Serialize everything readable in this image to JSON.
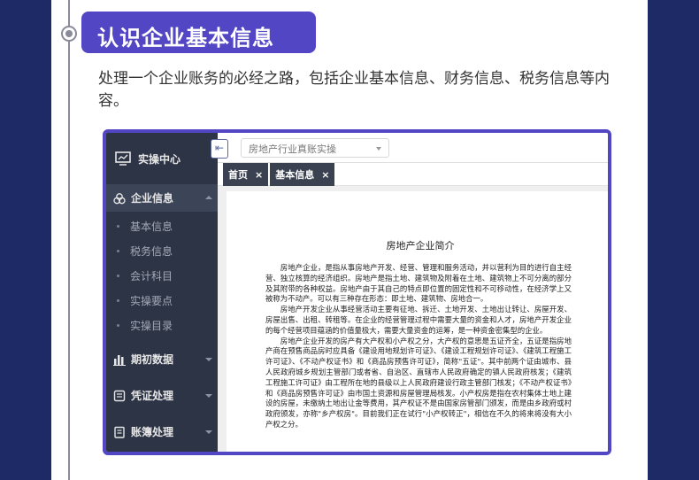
{
  "section": {
    "title": "认识企业基本信息",
    "description": "处理一个企业账务的必经之路，包括企业基本信息、财务信息、税务信息等内容。"
  },
  "app": {
    "sidebar": {
      "header": "实操中心",
      "items": [
        {
          "label": "企业信息",
          "icon": "company-icon",
          "expanded": true
        },
        {
          "label": "期初数据",
          "icon": "bar-chart-icon"
        },
        {
          "label": "凭证处理",
          "icon": "voucher-icon"
        },
        {
          "label": "账簿处理",
          "icon": "ledger-icon"
        }
      ],
      "sub_items": [
        "基本信息",
        "税务信息",
        "会计科目",
        "实操要点",
        "实操目录"
      ]
    },
    "topbar": {
      "collapse_icon": "collapse-icon",
      "select_value": "房地产行业真账实操"
    },
    "tabs": [
      {
        "label": "首页",
        "close": "×"
      },
      {
        "label": "基本信息",
        "close": "×"
      }
    ],
    "document": {
      "title": "房地产企业简介",
      "paragraphs": [
        "房地产企业，是指从事房地产开发、经营、管理和服务活动，并以营利为目的进行自主经营、独立核算的经济组织。房地产是指土地、建筑物及附着在土地、建筑物上不可分离的部分及其附带的各种权益。房地产由于其自己的特点即位置的固定性和不可移动性，在经济学上又被称为不动产。可以有三种存在形态：即土地、建筑物、房地合一。",
        "房地产开发企业从事经营活动主要有征地、拆迁、土地开发、土地出让转让、房屋开发、房屋出售、出租、转租等。在企业的经营管理过程中需要大量的资金和人才，房地产开发企业的每个经营项目蕴涵的价值量极大，需要大量资金的运筹，是一种资金密集型的企业。",
        "房地产企业开发的房产有大产权和小产权之分，大产权的意思是五证齐全，五证是指房地产商在预售商品房时应具备《建设用地规划许可证》、《建设工程规划许可证》、《建筑工程施工许可证》、《不动产权证书》和《商品房预售许可证》，简称\"五证\"。其中前两个证由城市、县人民政府城乡规划主管部门或者省、自治区、直辖市人民政府确定的镇人民政府核发；《建筑工程施工许可证》由工程所在地的县级以上人民政府建设行政主管部门核发；《不动产权证书》和《商品房预售许可证》由市国土资源和房屋管理局核发。小产权房是指在农村集体土地上建设的房屋，未缴纳土地出让金等费用，其产权证不是由国家房管部门颁发，而是由乡政府或村政府颁发，亦称\"乡产权房\"。目前我们正在试行\"小产权转正\"，相信在不久的将来将没有大小产权之分。"
      ]
    }
  },
  "colors": {
    "page_bg": "#1e2a66",
    "accent": "#5346c4",
    "sidebar_bg": "#2d3446",
    "tab_bg": "#3a4150"
  }
}
